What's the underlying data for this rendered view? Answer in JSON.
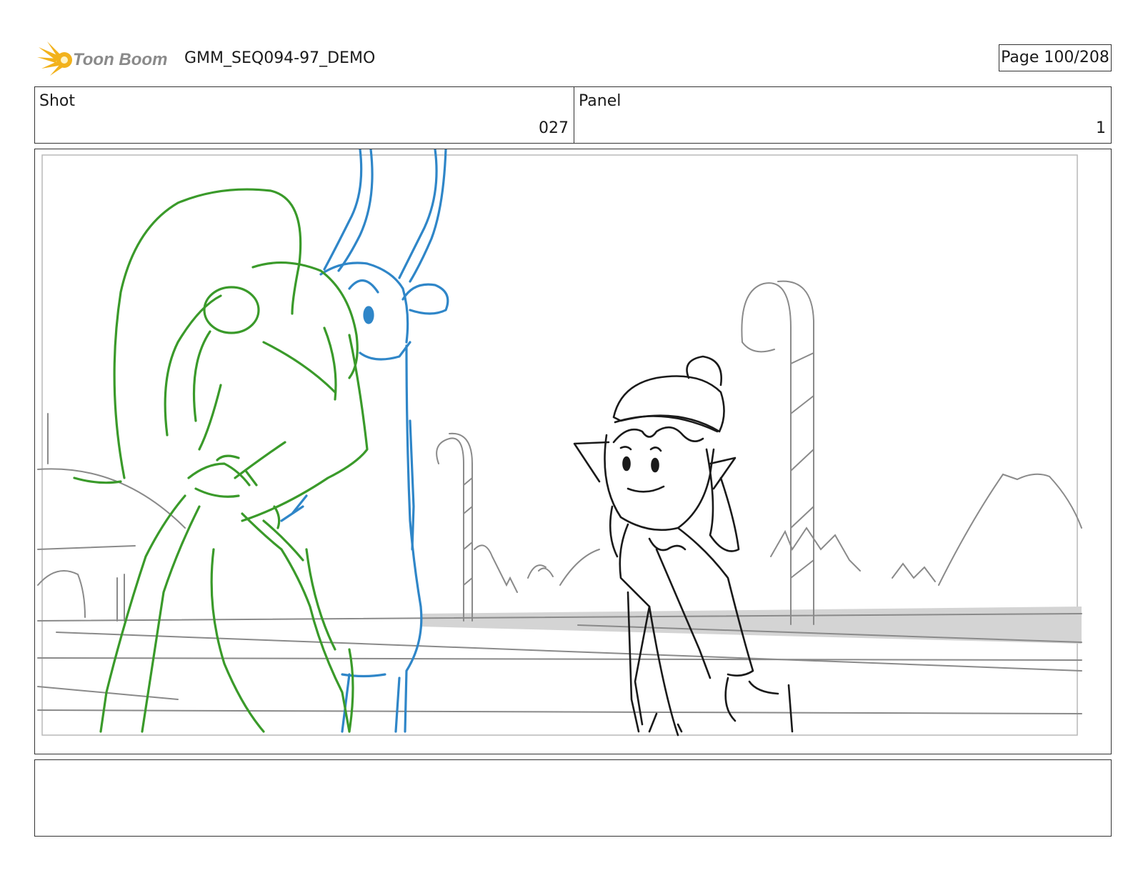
{
  "header": {
    "logo_text": "Toon Boom",
    "document_title": "GMM_SEQ094-97_DEMO",
    "page_label": "Page",
    "page_current": "100",
    "page_total": "208"
  },
  "shot": {
    "label": "Shot",
    "value": "027"
  },
  "panel": {
    "label": "Panel",
    "value": "1"
  },
  "caption": {
    "text": ""
  },
  "colors": {
    "green_character": "#3a9a2a",
    "blue_character": "#2f86c8",
    "ink": "#1a1a1a",
    "background_lines": "#8a8a8a",
    "logo_yellow": "#f2b21c",
    "logo_text": "#8a8a8a"
  }
}
